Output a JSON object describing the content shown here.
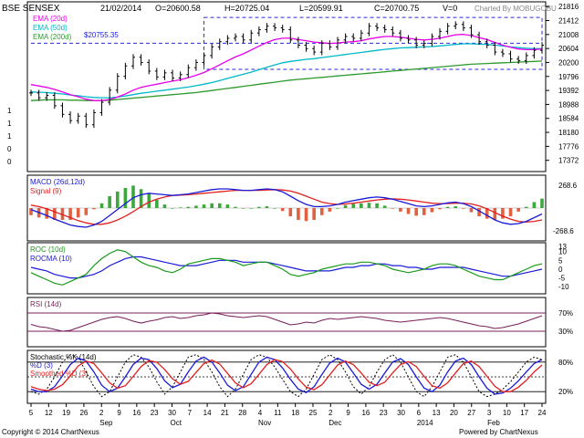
{
  "header": {
    "symbol": "BSE SENSEX",
    "date": "21/02/2014",
    "open": "O=20600.58",
    "high": "H=20725.04",
    "low": "L=20599.91",
    "close": "C=20700.75",
    "volume": "V=0",
    "credit": "Charted By MOBUGOBU"
  },
  "footer": {
    "copyright": "Copyright © 2014 ChartNexus",
    "powered": "Powered by ChartNexus"
  },
  "colors": {
    "ema20": "#e800e8",
    "ema50": "#00b8c8",
    "ema200": "#2e9a2e",
    "candle": "#000000",
    "macd": "#1a1ad8",
    "signal": "#e02020",
    "hist_pos": "#3aa83a",
    "hist_neg": "#e06040",
    "roc": "#1a9a1a",
    "rocma": "#1a1ad8",
    "rsi": "#7a1f5a",
    "band": "#7a1f5a",
    "k": "#000000",
    "d": "#1a1ad8",
    "smoothed": "#e02020",
    "dash_box": "#2a2ad8"
  },
  "chart_data": [
    {
      "type": "candlestick",
      "title": "BSE SENSEX",
      "legend": [
        "EMA (20d)",
        "EMA (50d)",
        "EMA (200d)"
      ],
      "annotation": "$20755.35",
      "ylim": [
        17100,
        21900
      ],
      "y_ticks_right": [
        "21816",
        "21412",
        "21008",
        "20604",
        "20200",
        "19796",
        "19392",
        "18988",
        "18584",
        "18180",
        "17776",
        "17372"
      ],
      "y_ticks_left": [
        "1",
        "1",
        "1",
        "0",
        "0"
      ],
      "x_day_labels": [
        "5",
        "12",
        "19",
        "26",
        "2",
        "9",
        "16",
        "23",
        "30",
        "7",
        "14",
        "21",
        "28",
        "4",
        "11",
        "18",
        "25",
        "2",
        "9",
        "16",
        "23",
        "30",
        "6",
        "13",
        "20",
        "27",
        "3",
        "10",
        "17",
        "24"
      ],
      "x_month_labels": [
        "Sep",
        "Oct",
        "Nov",
        "Dec",
        "2014",
        "Feb"
      ],
      "close": [
        19320,
        19180,
        19250,
        18950,
        18700,
        18520,
        18650,
        18400,
        18750,
        19050,
        19400,
        19800,
        20100,
        20350,
        20200,
        19950,
        19780,
        19900,
        19750,
        19850,
        20050,
        20200,
        20400,
        20650,
        20800,
        20900,
        20950,
        20850,
        21050,
        21150,
        21250,
        21200,
        21150,
        20850,
        20700,
        20600,
        20500,
        20750,
        20650,
        20850,
        20950,
        20900,
        21050,
        21250,
        21200,
        21150,
        21050,
        20900,
        20850,
        20700,
        20750,
        20950,
        21100,
        21250,
        21300,
        21200,
        21000,
        20800,
        20700,
        20500,
        20450,
        20300,
        20250,
        20400,
        20550,
        20700
      ],
      "ema20": [
        19560,
        19520,
        19480,
        19420,
        19350,
        19270,
        19210,
        19140,
        19100,
        19100,
        19130,
        19200,
        19290,
        19400,
        19480,
        19530,
        19570,
        19620,
        19660,
        19700,
        19760,
        19830,
        19910,
        20020,
        20130,
        20250,
        20360,
        20450,
        20560,
        20670,
        20780,
        20860,
        20900,
        20900,
        20860,
        20830,
        20790,
        20770,
        20750,
        20760,
        20790,
        20800,
        20830,
        20880,
        20920,
        20950,
        20950,
        20930,
        20900,
        20870,
        20850,
        20870,
        20900,
        20950,
        21000,
        21010,
        20980,
        20920,
        20860,
        20780,
        20700,
        20640,
        20590,
        20570,
        20570,
        20590
      ],
      "ema50": [
        19350,
        19340,
        19330,
        19310,
        19290,
        19260,
        19240,
        19210,
        19190,
        19180,
        19180,
        19200,
        19230,
        19270,
        19310,
        19340,
        19370,
        19400,
        19430,
        19460,
        19490,
        19530,
        19570,
        19620,
        19680,
        19740,
        19800,
        19860,
        19920,
        19990,
        20060,
        20130,
        20190,
        20230,
        20260,
        20290,
        20310,
        20340,
        20370,
        20400,
        20430,
        20460,
        20490,
        20520,
        20550,
        20580,
        20600,
        20620,
        20630,
        20640,
        20650,
        20660,
        20680,
        20700,
        20720,
        20740,
        20740,
        20730,
        20720,
        20700,
        20680,
        20650,
        20630,
        20610,
        20600,
        20600
      ],
      "ema200": [
        19100,
        19110,
        19120,
        19120,
        19120,
        19110,
        19110,
        19100,
        19100,
        19100,
        19110,
        19130,
        19150,
        19170,
        19190,
        19210,
        19230,
        19250,
        19270,
        19290,
        19310,
        19330,
        19360,
        19390,
        19420,
        19450,
        19480,
        19510,
        19540,
        19570,
        19600,
        19630,
        19660,
        19690,
        19710,
        19730,
        19750,
        19770,
        19790,
        19810,
        19830,
        19850,
        19870,
        19890,
        19910,
        19930,
        19950,
        19970,
        19990,
        20010,
        20030,
        20050,
        20070,
        20090,
        20110,
        20130,
        20150,
        20160,
        20170,
        20180,
        20190,
        20200,
        20210,
        20220,
        20230,
        20240
      ]
    },
    {
      "type": "line",
      "title": "MACD (26d,12d)",
      "legend": [
        "MACD (26d,12d)",
        "Signal (9)"
      ],
      "y_ticks": [
        "268.6",
        "-268.6"
      ],
      "ylim": [
        -420,
        420
      ],
      "macd": [
        -20,
        -60,
        -100,
        -150,
        -190,
        -230,
        -250,
        -260,
        -230,
        -180,
        -100,
        -20,
        60,
        140,
        180,
        200,
        190,
        180,
        170,
        180,
        190,
        210,
        230,
        250,
        260,
        260,
        250,
        240,
        240,
        250,
        260,
        250,
        220,
        160,
        100,
        50,
        20,
        20,
        30,
        50,
        80,
        100,
        120,
        140,
        150,
        140,
        120,
        90,
        60,
        30,
        20,
        30,
        50,
        70,
        80,
        60,
        20,
        -40,
        -100,
        -160,
        -200,
        -220,
        -210,
        -180,
        -130,
        -80
      ],
      "signal": [
        40,
        20,
        -10,
        -50,
        -90,
        -130,
        -170,
        -200,
        -220,
        -220,
        -200,
        -160,
        -110,
        -50,
        20,
        80,
        120,
        150,
        170,
        175,
        180,
        190,
        200,
        210,
        220,
        230,
        240,
        240,
        240,
        240,
        245,
        250,
        245,
        230,
        200,
        160,
        120,
        80,
        60,
        50,
        55,
        65,
        80,
        95,
        110,
        120,
        125,
        120,
        110,
        95,
        80,
        65,
        60,
        60,
        65,
        65,
        55,
        30,
        -10,
        -60,
        -110,
        -150,
        -180,
        -190,
        -180,
        -160
      ]
    },
    {
      "type": "line",
      "title": "ROC (10d)",
      "legend": [
        "ROC (10d)",
        "ROCMA (10)"
      ],
      "y_ticks": [
        "13",
        "10",
        "5",
        "0",
        "-5",
        "-10"
      ],
      "ylim": [
        -13,
        14
      ],
      "roc": [
        -2,
        -4,
        -6,
        -8,
        -9,
        -7,
        -5,
        -3,
        2,
        6,
        9,
        11,
        10,
        7,
        4,
        2,
        1,
        -1,
        -2,
        0,
        3,
        4,
        5,
        6,
        6,
        5,
        4,
        2,
        3,
        4,
        4,
        2,
        0,
        -3,
        -4,
        -3,
        -2,
        0,
        1,
        2,
        3,
        3,
        4,
        4,
        3,
        2,
        0,
        -1,
        -2,
        -1,
        0,
        2,
        3,
        3,
        2,
        0,
        -2,
        -4,
        -5,
        -6,
        -6,
        -4,
        -2,
        0,
        2,
        3
      ],
      "rocma": [
        1,
        0,
        -1,
        -3,
        -4,
        -5,
        -5,
        -4,
        -3,
        -1,
        2,
        4,
        6,
        7,
        7,
        6,
        5,
        4,
        3,
        2,
        2,
        2,
        3,
        4,
        5,
        5,
        5,
        4,
        4,
        4,
        4,
        3,
        2,
        1,
        0,
        -1,
        -1,
        -1,
        -1,
        0,
        1,
        1,
        2,
        2,
        3,
        3,
        2,
        2,
        1,
        1,
        0,
        0,
        1,
        1,
        1,
        1,
        0,
        -1,
        -2,
        -3,
        -4,
        -4,
        -3,
        -2,
        -1,
        0
      ]
    },
    {
      "type": "line",
      "title": "RSI (14d)",
      "y_ticks": [
        "70%",
        "30%"
      ],
      "ylim": [
        0,
        100
      ],
      "bands": [
        70,
        30
      ],
      "rsi": [
        45,
        40,
        38,
        34,
        30,
        32,
        38,
        44,
        50,
        56,
        60,
        62,
        58,
        52,
        48,
        52,
        55,
        60,
        62,
        58,
        60,
        64,
        66,
        70,
        68,
        64,
        62,
        60,
        62,
        64,
        62,
        56,
        50,
        44,
        46,
        50,
        48,
        54,
        58,
        56,
        58,
        60,
        62,
        60,
        58,
        54,
        52,
        50,
        52,
        54,
        56,
        58,
        60,
        58,
        54,
        50,
        46,
        42,
        40,
        36,
        38,
        42,
        46,
        52,
        58,
        64
      ]
    },
    {
      "type": "line",
      "title": "Stochastic %K (14d)",
      "legend": [
        "Stochastic %K (14d)",
        "%D (3)",
        "Smoothed %D (3)"
      ],
      "y_ticks": [
        "80%",
        "20%"
      ],
      "ylim": [
        0,
        100
      ],
      "bands": [
        80,
        50,
        20
      ],
      "k": [
        20,
        15,
        25,
        50,
        80,
        95,
        90,
        60,
        30,
        10,
        20,
        50,
        80,
        95,
        90,
        70,
        40,
        15,
        30,
        60,
        90,
        95,
        85,
        60,
        30,
        10,
        25,
        55,
        85,
        95,
        90,
        70,
        45,
        20,
        10,
        25,
        55,
        85,
        95,
        85,
        60,
        30,
        15,
        30,
        60,
        85,
        95,
        80,
        50,
        20,
        10,
        30,
        60,
        90,
        95,
        80,
        50,
        20,
        10,
        15,
        25,
        40,
        60,
        80,
        90,
        85
      ],
      "d": [
        25,
        20,
        20,
        30,
        52,
        75,
        88,
        82,
        60,
        33,
        20,
        27,
        50,
        75,
        88,
        85,
        67,
        42,
        28,
        35,
        60,
        82,
        90,
        80,
        58,
        33,
        22,
        30,
        55,
        80,
        90,
        85,
        68,
        45,
        25,
        18,
        30,
        55,
        78,
        88,
        80,
        58,
        35,
        25,
        35,
        58,
        80,
        87,
        75,
        50,
        27,
        20,
        33,
        60,
        82,
        88,
        75,
        50,
        27,
        15,
        17,
        27,
        42,
        60,
        77,
        85
      ],
      "smoothed": [
        30,
        25,
        22,
        25,
        34,
        52,
        72,
        82,
        77,
        58,
        38,
        27,
        32,
        51,
        71,
        83,
        80,
        65,
        46,
        35,
        41,
        59,
        77,
        84,
        76,
        57,
        38,
        28,
        36,
        55,
        75,
        85,
        81,
        66,
        46,
        29,
        24,
        34,
        54,
        74,
        82,
        75,
        58,
        39,
        32,
        39,
        58,
        75,
        81,
        71,
        51,
        32,
        27,
        38,
        58,
        77,
        82,
        71,
        51,
        31,
        20,
        20,
        29,
        43,
        60,
        74
      ]
    }
  ]
}
